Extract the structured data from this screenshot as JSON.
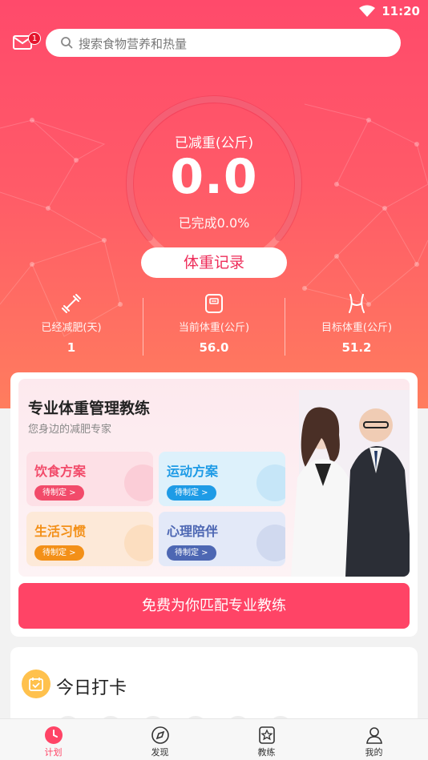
{
  "status_bar": {
    "time": "11:20"
  },
  "header": {
    "mail_badge": "1",
    "search_placeholder": "搜索食物营养和热量"
  },
  "progress": {
    "title": "已减重(公斤)",
    "value": "0.0",
    "completed_text": "已完成0.0%",
    "completed_fraction": 0.0,
    "record_button": "体重记录"
  },
  "stats": [
    {
      "label": "已经减肥(天)",
      "value": "1",
      "icon": "dumbbell-icon"
    },
    {
      "label": "当前体重(公斤)",
      "value": "56.0",
      "icon": "scale-icon"
    },
    {
      "label": "目标体重(公斤)",
      "value": "51.2",
      "icon": "waist-icon"
    }
  ],
  "coach": {
    "title": "专业体重管理教练",
    "subtitle": "您身边的减肥专家",
    "tiles": [
      {
        "title": "饮食方案",
        "status": "待制定 >",
        "color": "#f24b6a",
        "bg": "#fde0e6"
      },
      {
        "title": "运动方案",
        "status": "待制定 >",
        "color": "#1e9be6",
        "bg": "#ddf1fb"
      },
      {
        "title": "生活习惯",
        "status": "待制定 >",
        "color": "#f39018",
        "bg": "#fde9d8"
      },
      {
        "title": "心理陪伴",
        "status": "待制定 >",
        "color": "#4d67b3",
        "bg": "#e3e9f8"
      }
    ],
    "match_button": "免费为你匹配专业教练"
  },
  "checkin": {
    "title": "今日打卡"
  },
  "tabs": [
    {
      "label": "计划",
      "icon": "clock-icon",
      "active": true
    },
    {
      "label": "发现",
      "icon": "compass-icon",
      "active": false
    },
    {
      "label": "教练",
      "icon": "star-badge-icon",
      "active": false
    },
    {
      "label": "我的",
      "icon": "person-icon",
      "active": false
    }
  ],
  "colors": {
    "accent": "#ff4466",
    "hero_top": "#ff4a6b",
    "hero_bottom": "#ff7d5e"
  }
}
